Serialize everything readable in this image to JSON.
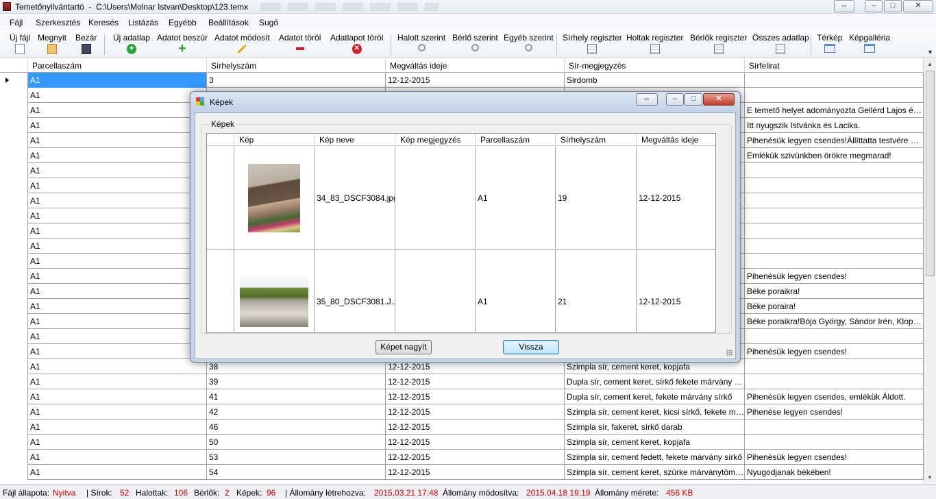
{
  "window": {
    "app_name": "Temetőnyilvántartó",
    "separator": "-",
    "file_path": "C:\\Users\\Molnar Istvan\\Desktop\\123.temx",
    "controls": {
      "resize": "⇔",
      "minimize": "–",
      "maximize": "□",
      "close": "✕"
    }
  },
  "menu": [
    "Fájl",
    "Szerkesztés",
    "Keresés",
    "Listázás",
    "Egyébb",
    "Beállítások",
    "Sugó"
  ],
  "toolbar": [
    {
      "label": "Új fájl",
      "icon": "new-file-icon"
    },
    {
      "label": "Megnyit",
      "icon": "open-folder-icon"
    },
    {
      "label": "Bezár",
      "icon": "save-icon"
    },
    {
      "label": "Új adatlap",
      "icon": "add-circle-icon"
    },
    {
      "label": "Adatot beszúr",
      "icon": "plus-icon"
    },
    {
      "label": "Adatot módosít",
      "icon": "pencil-icon"
    },
    {
      "label": "Adatot töröl",
      "icon": "minus-icon"
    },
    {
      "label": "Adatlapot töröl",
      "icon": "delete-circle-icon"
    },
    {
      "label": "Halott szerint",
      "icon": "search-icon"
    },
    {
      "label": "Bérlő szerint",
      "icon": "search-icon"
    },
    {
      "label": "Egyéb szerint",
      "icon": "search-icon"
    },
    {
      "label": "Sírhely regiszter",
      "icon": "register-icon"
    },
    {
      "label": "Holtak regiszter",
      "icon": "register-icon"
    },
    {
      "label": "Bérlők regiszter",
      "icon": "register-icon"
    },
    {
      "label": "Összes adatlap",
      "icon": "register-icon"
    },
    {
      "label": "Térkép",
      "icon": "window-icon"
    },
    {
      "label": "Képgalléria",
      "icon": "window-icon"
    }
  ],
  "grid": {
    "columns": [
      "Parcellaszám",
      "Sírhelyszám",
      "Megváltás ideje",
      "Sír-megjegyzés",
      "Sírfelirat"
    ],
    "rows": [
      [
        "A1",
        "3",
        "12-12-2015",
        "Sirdomb",
        ""
      ],
      [
        "A1",
        "",
        "",
        "",
        ""
      ],
      [
        "A1",
        "",
        "",
        "",
        "E temető helyet adományozta Gellérd Lajos és neje ..."
      ],
      [
        "A1",
        "",
        "",
        "",
        "Itt nyugszik Istvánka és Lacika."
      ],
      [
        "A1",
        "",
        "",
        "",
        "Pihenésük legyen csendes!Állíttatta testvére Ferenc."
      ],
      [
        "A1",
        "",
        "",
        "",
        "Emlékük szivünkben örökre megmarad!"
      ],
      [
        "A1",
        "",
        "",
        "",
        ""
      ],
      [
        "A1",
        "",
        "",
        "",
        ""
      ],
      [
        "A1",
        "",
        "",
        "",
        ""
      ],
      [
        "A1",
        "",
        "",
        "",
        ""
      ],
      [
        "A1",
        "",
        "",
        "",
        ""
      ],
      [
        "A1",
        "",
        "",
        "",
        ""
      ],
      [
        "A1",
        "",
        "",
        "",
        ""
      ],
      [
        "A1",
        "",
        "",
        "",
        "Pihenésük legyen csendes!"
      ],
      [
        "A1",
        "",
        "",
        "",
        "Béke poraikra!"
      ],
      [
        "A1",
        "",
        "",
        "",
        "Béke poraira!"
      ],
      [
        "A1",
        "",
        "",
        "",
        "Béke poraikra!Bója György, Sándor Irén, Klopfer Sá..."
      ],
      [
        "A1",
        "",
        "",
        "",
        ""
      ],
      [
        "A1",
        "",
        "",
        "",
        "Pihenésük legyen csendes!"
      ],
      [
        "A1",
        "38",
        "12-12-2015",
        "Szimpla sír, cement keret, kopjafa",
        ""
      ],
      [
        "A1",
        "39",
        "12-12-2015",
        "Dupla sír, cement keret, sírkő fekete márvány lappal",
        ""
      ],
      [
        "A1",
        "41",
        "12-12-2015",
        "Dupla sír, cement keret, fekete márvány sírkő",
        "Pihenésük legyen csendes, emlékük Áldott."
      ],
      [
        "A1",
        "42",
        "12-12-2015",
        "Szimpla sír, cement keret, kicsi sírkő, fekete márvá...",
        "Pihenése legyen csendes!"
      ],
      [
        "A1",
        "46",
        "12-12-2015",
        "Szimpla sír, fakeret, sírkő darab",
        ""
      ],
      [
        "A1",
        "50",
        "12-12-2015",
        "Szimpla sír, cement keret, kopjafa",
        ""
      ],
      [
        "A1",
        "53",
        "12-12-2015",
        "Szimpla sír, cement fedett, fekete márvány sírkő",
        "Pihenésük legyen csendes!"
      ],
      [
        "A1",
        "54",
        "12-12-2015",
        "Szimpla sír, cement keret, szürke márványtömb lecs...",
        "Nyugodjanak békében!"
      ]
    ]
  },
  "status": {
    "file_state_label": "Fájl állapota:",
    "file_state_value": "Nyitva",
    "graves_label": "| Sírok:",
    "graves_value": "52",
    "dead_label": "Halottak:",
    "dead_value": "106",
    "tenants_label": "Bérlők:",
    "tenants_value": "2",
    "images_label": "Képek:",
    "images_value": "96",
    "created_label": "| Állomány létrehozva:",
    "created_value": "2015.03.21 17:48",
    "modified_label": "Állomány módosítva:",
    "modified_value": "2015.04.18 19:19",
    "size_label": "Állomány mérete:",
    "size_value": "456 KB"
  },
  "dialog": {
    "title": "Képek",
    "group_label": "Képek",
    "columns": [
      "Kép",
      "Kép neve",
      "Kép megjegyzés",
      "Parcellaszám",
      "Sírhelyszám",
      "Megváltás ideje"
    ],
    "rows": [
      {
        "image": "gravestone-photo",
        "name": "34_83_DSCF3084.jpg",
        "note": "",
        "parcel": "A1",
        "grave": "19",
        "date": "12-12-2015"
      },
      {
        "image": "cemetery-photo",
        "name": "35_80_DSCF3081.J...",
        "note": "",
        "parcel": "A1",
        "grave": "21",
        "date": "12-12-2015"
      }
    ],
    "enlarge_button": "Képet nagyít",
    "back_button": "Vissza"
  }
}
